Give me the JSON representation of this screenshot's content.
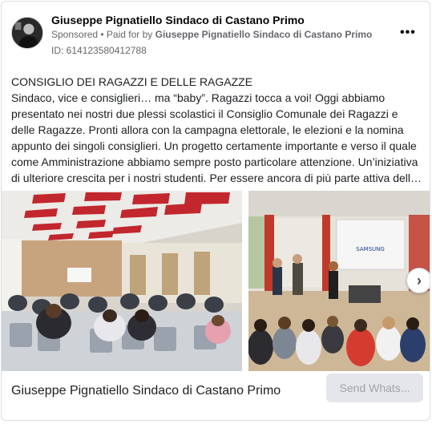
{
  "ad": {
    "page_name": "Giuseppe Pignatiello Sindaco di Castano Primo",
    "sponsored_label": "Sponsored",
    "separator": " • ",
    "paid_for_prefix": "Paid for by ",
    "paid_for_name": "Giuseppe Pignatiello Sindaco di Castano Primo",
    "ad_id": "ID: 614123580412788",
    "more_icon": "more-horizontal-icon"
  },
  "post": {
    "headline": "CONSIGLIO DEI RAGAZZI E DELLE RAGAZZE",
    "body": "Sindaco, vice e consiglieri… ma “baby”. Ragazzi tocca a voi! Oggi abbiamo presentato nei nostri due plessi scolastici il Consiglio Comunale dei Ragazzi e delle Ragazze. Pronti allora con la campagna elettorale, le elezioni e la nomina appunto dei singoli consiglieri. Un progetto certamente importante e verso il quale come Amministrazione abbiamo sempre posto particolare attenzione. Un’iniziativa di ulteriore crescita per i nostri studenti. Per essere ancora di più parte attiva dell…"
  },
  "carousel": {
    "next_icon": "chevron-right-icon",
    "next_glyph": "›",
    "slide2_screen_text": "SAMSUNG"
  },
  "footer": {
    "title": "Giuseppe Pignatiello Sindaco di Castano Primo",
    "cta_label": "Send Whats..."
  },
  "colors": {
    "text": "#1c1e21",
    "secondary": "#65676b",
    "cta_bg": "#e4e6eb",
    "cta_text": "#a0a3a8",
    "border": "#dadde1"
  }
}
